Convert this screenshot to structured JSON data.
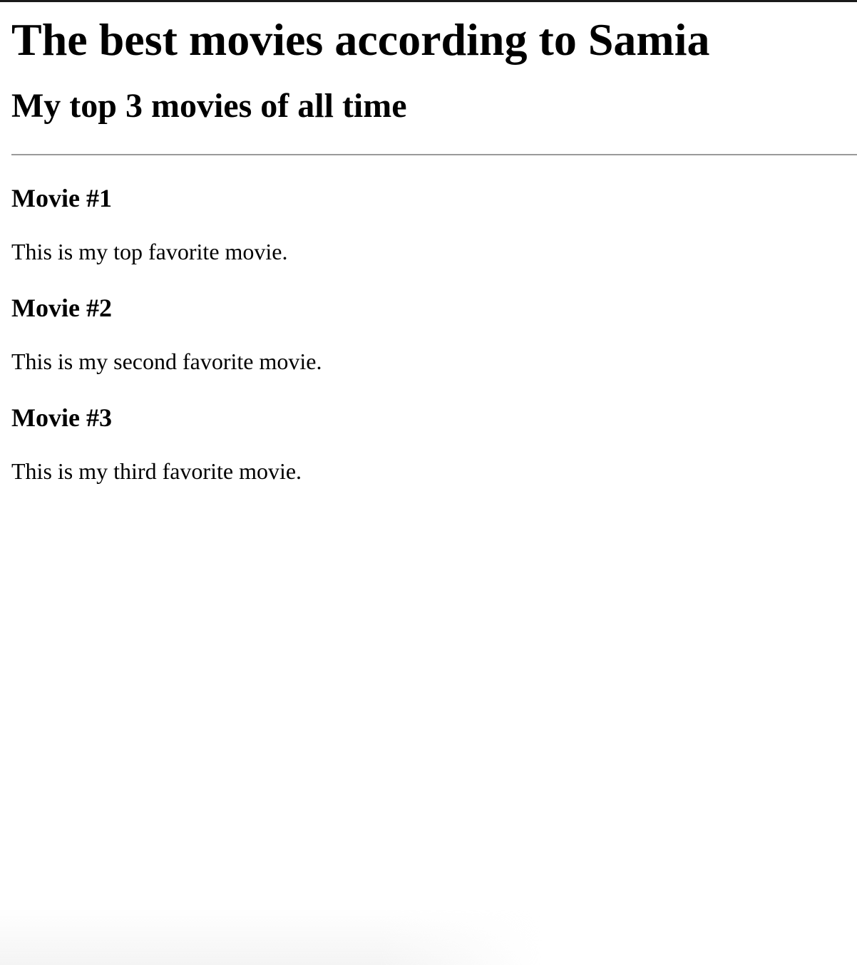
{
  "header": {
    "title": "The best movies according to Samia",
    "subtitle": "My top 3 movies of all time"
  },
  "movies": [
    {
      "heading": "Movie #1",
      "description": "This is my top favorite movie."
    },
    {
      "heading": "Movie #2",
      "description": "This is my second favorite movie."
    },
    {
      "heading": "Movie #3",
      "description": "This is my third favorite movie."
    }
  ]
}
